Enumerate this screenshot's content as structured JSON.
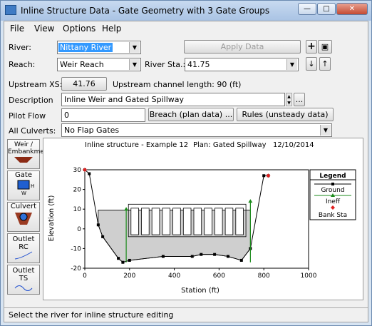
{
  "window": {
    "title": "Inline Structure Data - Gate Geometry with 3 Gate Groups"
  },
  "menu": [
    "File",
    "View",
    "Options",
    "Help"
  ],
  "form": {
    "river_label": "River:",
    "river_value": "Nittany River",
    "apply_label": "Apply Data",
    "reach_label": "Reach:",
    "reach_value": "Weir Reach",
    "riversta_label": "River Sta.:",
    "riversta_value": "41.75",
    "upstream_xs_label": "Upstream XS:",
    "upstream_xs_value": "41.76",
    "channel_length": "Upstream channel length: 90 (ft)",
    "description_label": "Description",
    "description_value": "Inline Weir and Gated Spillway",
    "ellipsis": "...",
    "pilot_label": "Pilot Flow",
    "pilot_value": "0",
    "breach_label": "Breach (plan data) ...",
    "rules_label": "Rules (unsteady data) ...",
    "culverts_label": "All Culverts:",
    "culverts_value": "No Flap Gates"
  },
  "sidebar": [
    {
      "label": "Weir / Embankment"
    },
    {
      "label": "Gate"
    },
    {
      "label": "Culvert"
    },
    {
      "label": "Outlet RC"
    },
    {
      "label": "Outlet TS"
    }
  ],
  "chart_data": {
    "type": "line",
    "title": "Inline structure - Example 12",
    "plan": "Plan: Gated Spillway",
    "date": "12/10/2014",
    "xlabel": "Station (ft)",
    "ylabel": "Elevation (ft)",
    "xlim": [
      0,
      1000
    ],
    "ylim": [
      -20,
      30
    ],
    "xticks": [
      0,
      200,
      400,
      600,
      800,
      1000
    ],
    "yticks": [
      -20,
      -10,
      0,
      10,
      20,
      30
    ],
    "ground": {
      "x": [
        0,
        20,
        60,
        80,
        150,
        170,
        200,
        350,
        480,
        520,
        580,
        640,
        700,
        740,
        800,
        820
      ],
      "y": [
        30,
        28,
        2,
        -4,
        -15,
        -17,
        -16,
        -14,
        -14,
        -13,
        -13,
        -14,
        -16,
        -10,
        27,
        27
      ]
    },
    "weir": {
      "x": [
        60,
        740
      ],
      "y": [
        9.5,
        9.5
      ]
    },
    "gates": {
      "count": 11,
      "x_start": 200,
      "x_end": 715,
      "bottom": -3,
      "top": 10.5
    },
    "ineff": [
      {
        "x": 185,
        "y": 10
      },
      {
        "x": 740,
        "y": 14
      }
    ],
    "bank_sta": [
      {
        "x": 0,
        "y": 30
      },
      {
        "x": 820,
        "y": 27
      }
    ],
    "legend": {
      "title": "Legend",
      "items": [
        "Ground",
        "Ineff",
        "Bank Sta"
      ]
    }
  },
  "status": "Select the river for inline structure editing"
}
